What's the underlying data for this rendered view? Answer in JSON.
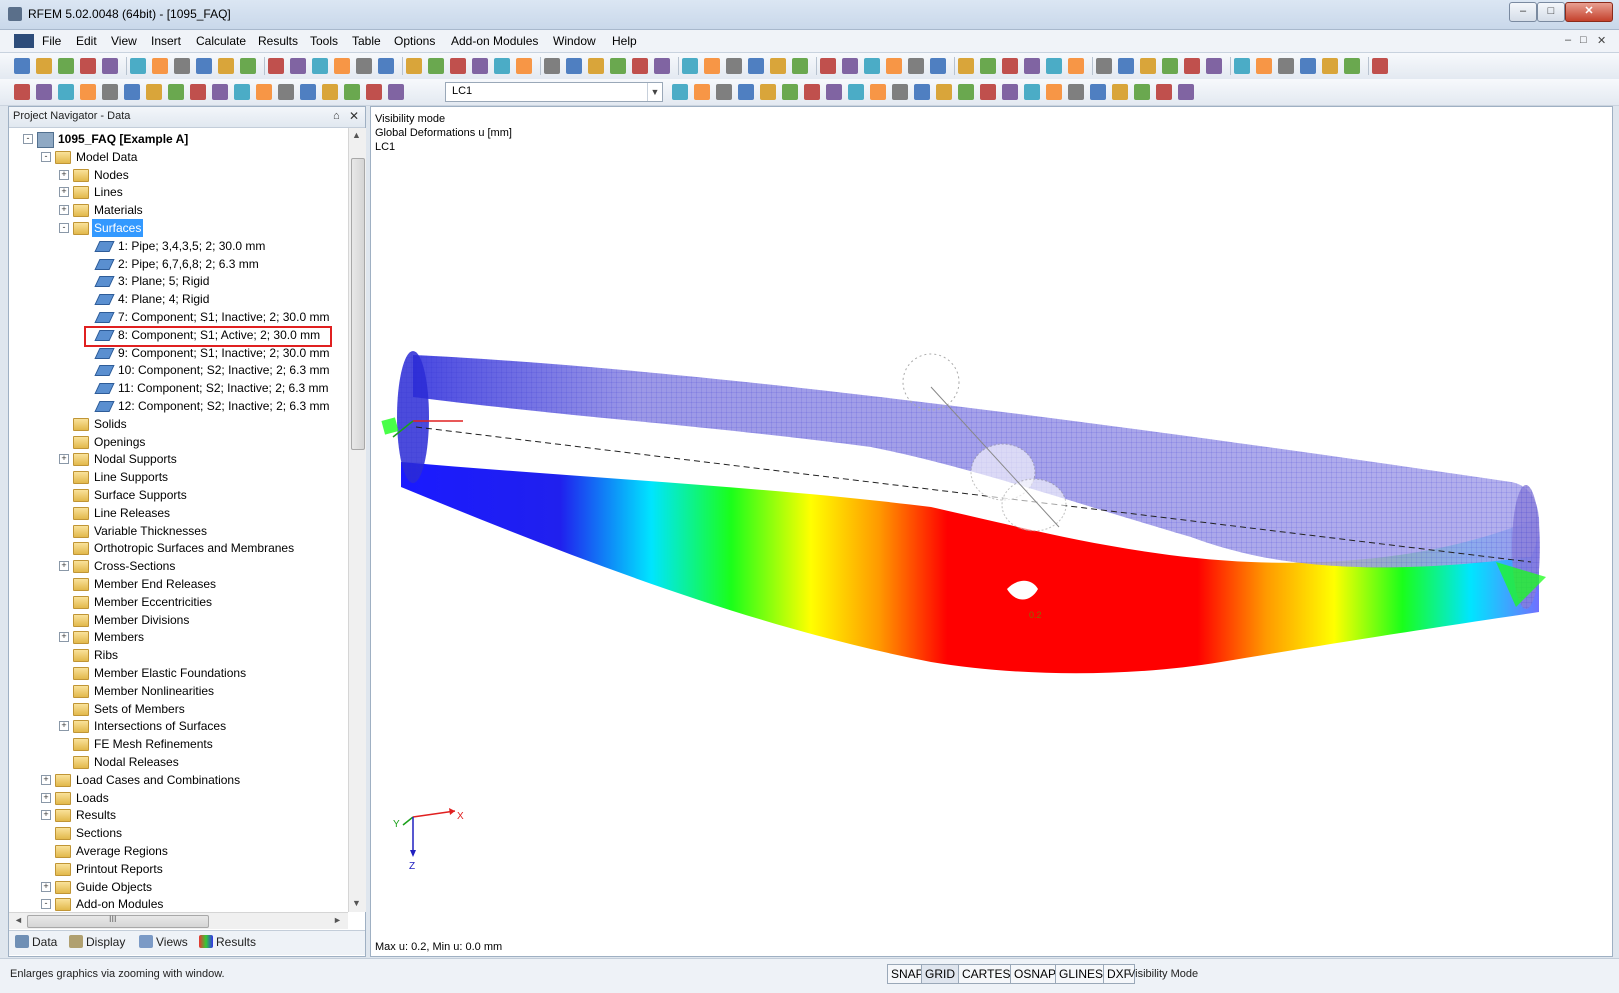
{
  "window": {
    "title": "RFEM 5.02.0048 (64bit) - [1095_FAQ]",
    "minimize": "–",
    "maximize": "□",
    "close": "✕"
  },
  "menu": [
    "File",
    "Edit",
    "View",
    "Insert",
    "Calculate",
    "Results",
    "Tools",
    "Table",
    "Options",
    "Add-on Modules",
    "Window",
    "Help"
  ],
  "mdi_controls": [
    "–",
    "□",
    "✕"
  ],
  "toolbar": {
    "load_case": "LC1",
    "dropdown_arrow": "▼"
  },
  "navigator": {
    "title": "Project Navigator - Data",
    "pin": "⌂",
    "close": "✕",
    "tree": [
      {
        "label": "1095_FAQ [Example A]",
        "level": 0,
        "exp": "-",
        "icon": "project",
        "bold": true
      },
      {
        "label": "Model Data",
        "level": 1,
        "exp": "-",
        "icon": "folder"
      },
      {
        "label": "Nodes",
        "level": 2,
        "exp": "+",
        "icon": "folder"
      },
      {
        "label": "Lines",
        "level": 2,
        "exp": "+",
        "icon": "folder"
      },
      {
        "label": "Materials",
        "level": 2,
        "exp": "+",
        "icon": "folder"
      },
      {
        "label": "Surfaces",
        "level": 2,
        "exp": "-",
        "icon": "folder",
        "selected": true
      },
      {
        "label": "1: Pipe; 3,4,3,5; 2; 30.0 mm",
        "level": 3,
        "icon": "surface"
      },
      {
        "label": "2: Pipe; 6,7,6,8; 2; 6.3 mm",
        "level": 3,
        "icon": "surface"
      },
      {
        "label": "3: Plane; 5; Rigid",
        "level": 3,
        "icon": "surface"
      },
      {
        "label": "4: Plane; 4; Rigid",
        "level": 3,
        "icon": "surface"
      },
      {
        "label": "7: Component; S1; Inactive; 2; 30.0 mm",
        "level": 3,
        "icon": "surface"
      },
      {
        "label": "8: Component; S1; Active; 2; 30.0 mm",
        "level": 3,
        "icon": "surface",
        "highlight": true
      },
      {
        "label": "9: Component; S1; Inactive; 2; 30.0 mm",
        "level": 3,
        "icon": "surface"
      },
      {
        "label": "10: Component; S2; Inactive; 2; 6.3 mm",
        "level": 3,
        "icon": "surface"
      },
      {
        "label": "11: Component; S2; Inactive; 2; 6.3 mm",
        "level": 3,
        "icon": "surface"
      },
      {
        "label": "12: Component; S2; Inactive; 2; 6.3 mm",
        "level": 3,
        "icon": "surface"
      },
      {
        "label": "Solids",
        "level": 2,
        "icon": "folder"
      },
      {
        "label": "Openings",
        "level": 2,
        "icon": "folder"
      },
      {
        "label": "Nodal Supports",
        "level": 2,
        "exp": "+",
        "icon": "folder"
      },
      {
        "label": "Line Supports",
        "level": 2,
        "icon": "folder"
      },
      {
        "label": "Surface Supports",
        "level": 2,
        "icon": "folder"
      },
      {
        "label": "Line Releases",
        "level": 2,
        "icon": "folder"
      },
      {
        "label": "Variable Thicknesses",
        "level": 2,
        "icon": "folder"
      },
      {
        "label": "Orthotropic Surfaces and Membranes",
        "level": 2,
        "icon": "folder"
      },
      {
        "label": "Cross-Sections",
        "level": 2,
        "exp": "+",
        "icon": "folder"
      },
      {
        "label": "Member End Releases",
        "level": 2,
        "icon": "folder"
      },
      {
        "label": "Member Eccentricities",
        "level": 2,
        "icon": "folder"
      },
      {
        "label": "Member Divisions",
        "level": 2,
        "icon": "folder"
      },
      {
        "label": "Members",
        "level": 2,
        "exp": "+",
        "icon": "folder"
      },
      {
        "label": "Ribs",
        "level": 2,
        "icon": "folder"
      },
      {
        "label": "Member Elastic Foundations",
        "level": 2,
        "icon": "folder"
      },
      {
        "label": "Member Nonlinearities",
        "level": 2,
        "icon": "folder"
      },
      {
        "label": "Sets of Members",
        "level": 2,
        "icon": "folder"
      },
      {
        "label": "Intersections of Surfaces",
        "level": 2,
        "exp": "+",
        "icon": "folder"
      },
      {
        "label": "FE Mesh Refinements",
        "level": 2,
        "icon": "folder"
      },
      {
        "label": "Nodal Releases",
        "level": 2,
        "icon": "folder"
      },
      {
        "label": "Load Cases and Combinations",
        "level": 1,
        "exp": "+",
        "icon": "folder"
      },
      {
        "label": "Loads",
        "level": 1,
        "exp": "+",
        "icon": "folder"
      },
      {
        "label": "Results",
        "level": 1,
        "exp": "+",
        "icon": "folder"
      },
      {
        "label": "Sections",
        "level": 1,
        "icon": "folder"
      },
      {
        "label": "Average Regions",
        "level": 1,
        "icon": "folder"
      },
      {
        "label": "Printout Reports",
        "level": 1,
        "icon": "folder"
      },
      {
        "label": "Guide Objects",
        "level": 1,
        "exp": "+",
        "icon": "folder"
      },
      {
        "label": "Add-on Modules",
        "level": 1,
        "exp": "-",
        "icon": "folder"
      }
    ],
    "tabs": [
      "Data",
      "Display",
      "Views",
      "Results"
    ],
    "scroll_up": "▲",
    "scroll_down": "▼",
    "scroll_left": "◄",
    "scroll_right": "►",
    "scroll_grip": "III",
    "vscroll_grip": "≡"
  },
  "graphics": {
    "info_lines": [
      "Visibility mode",
      "Global Deformations u [mm]",
      "LC1"
    ],
    "max_label": "0.2",
    "max_min": "Max u: 0.2, Min u: 0.0 mm",
    "axis_x": "X",
    "axis_y": "Y",
    "axis_z": "Z",
    "colors": {
      "blue": "#1a1aff",
      "cyan": "#00e5ff",
      "green": "#1aff1a",
      "yellow": "#ffff00",
      "orange": "#ff9900",
      "red": "#ff0000",
      "lavender": "#9c98e8"
    }
  },
  "statusbar": {
    "message": "Enlarges graphics via zooming with window.",
    "buttons": [
      "SNAP",
      "GRID",
      "CARTES",
      "OSNAP",
      "GLINES",
      "DXF"
    ],
    "pressed": [
      "GRID"
    ],
    "mode": "Visibility Mode"
  }
}
